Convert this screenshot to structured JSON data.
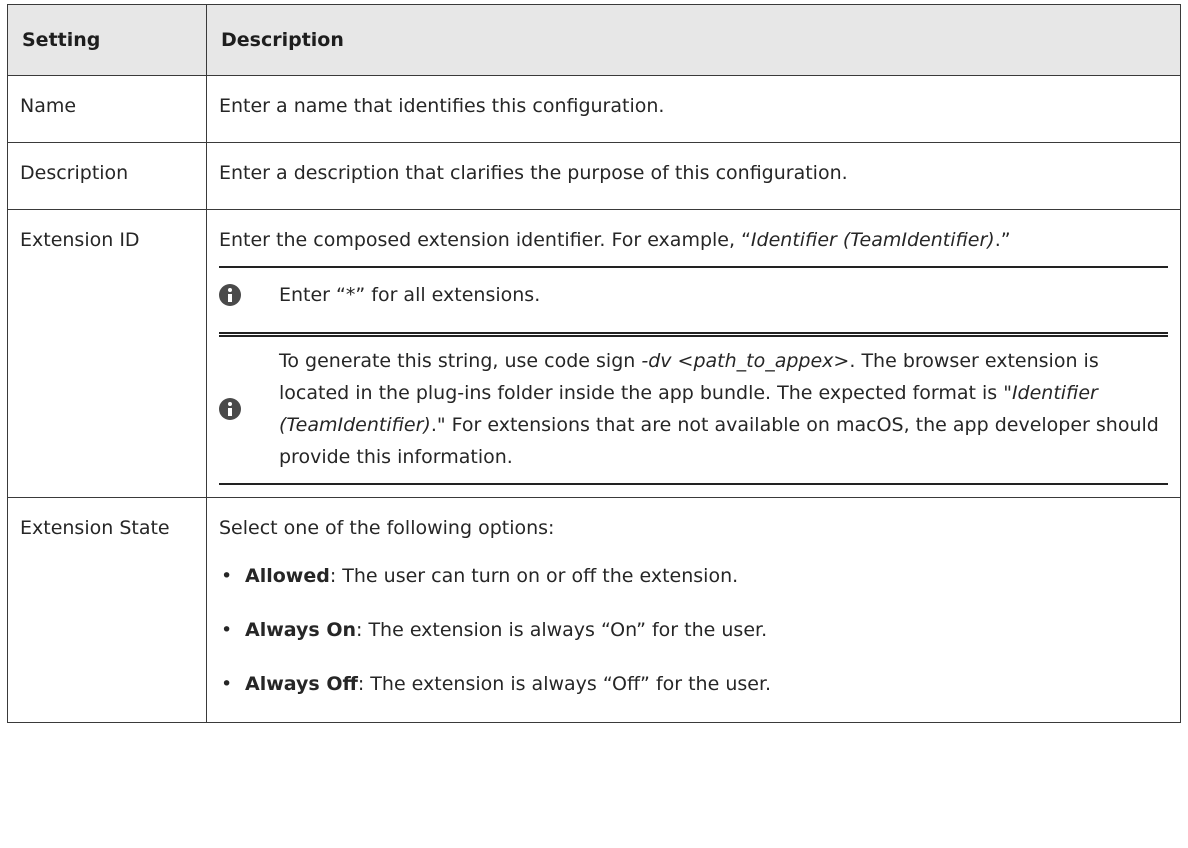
{
  "headers": {
    "setting": "Setting",
    "description": "Description"
  },
  "rows": {
    "name": {
      "setting": "Name",
      "description": "Enter a name that identifies this configuration."
    },
    "description": {
      "setting": "Description",
      "description": "Enter a description that clarifies the purpose of this configuration."
    },
    "extension_id": {
      "setting": "Extension ID",
      "description_pre": "Enter the composed extension identifier. For example, “",
      "description_ital": "Identifier (TeamIdentifier)",
      "description_post": ".”",
      "note1": "Enter “*” for all extensions.",
      "note2_a": "To generate this string, use code sign ",
      "note2_b": "-dv <path_to_appex>",
      "note2_c": ". The browser extension is located in the plug-ins folder inside the app bundle. The expected format is \"",
      "note2_d": "Identifier (TeamIdentifier)",
      "note2_e": ".\" For extensions that are not available on macOS, the app developer should provide this information."
    },
    "extension_state": {
      "setting": "Extension State",
      "intro": "Select one of the following options:",
      "options": [
        {
          "label": "Allowed",
          "text": ": The user can turn on or off the extension."
        },
        {
          "label": "Always On",
          "text": ": The extension is always “On” for the user."
        },
        {
          "label": "Always Off",
          "text": ": The extension is always “Off” for the user."
        }
      ]
    }
  },
  "icons": {
    "note": "info-icon"
  },
  "colors": {
    "header_bg": "#e7e7e7",
    "border": "#3a3a3a",
    "icon": "#4a4a4a"
  }
}
